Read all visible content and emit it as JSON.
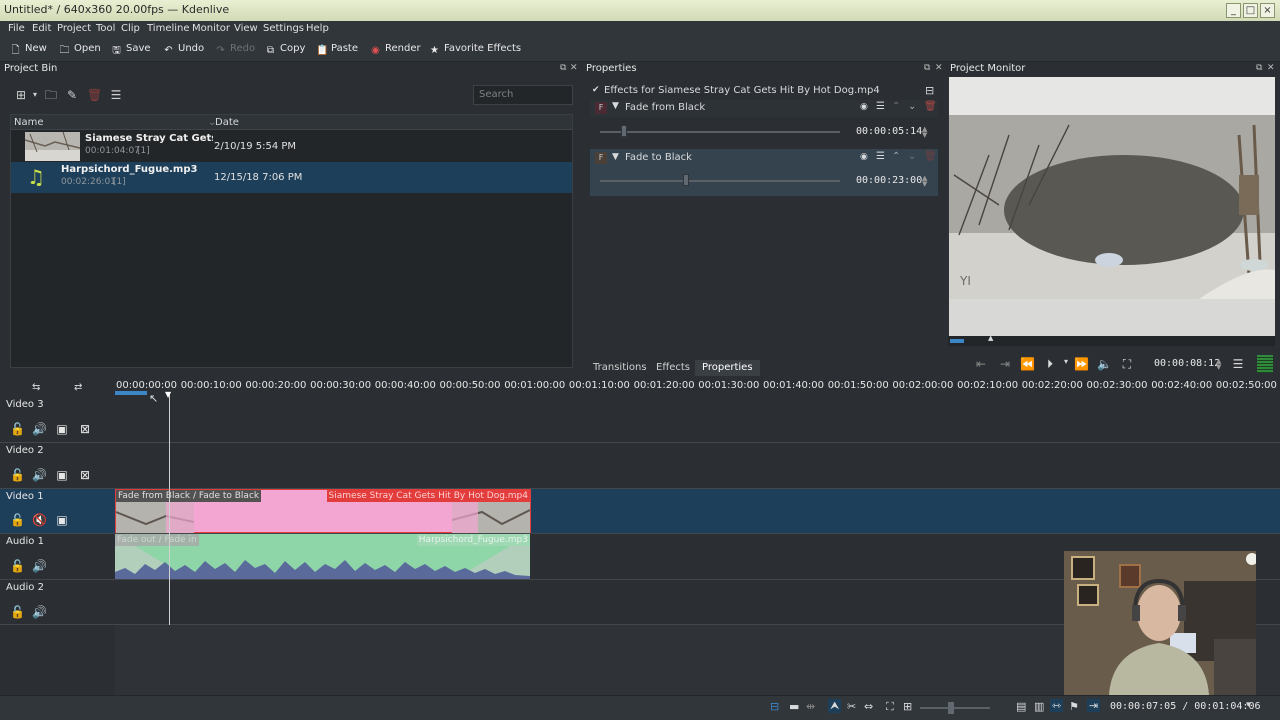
{
  "window": {
    "title": "Untitled* / 640x360 20.00fps — Kdenlive"
  },
  "menu": [
    "File",
    "Edit",
    "Project",
    "Tool",
    "Clip",
    "Timeline",
    "Monitor",
    "View",
    "Settings",
    "Help"
  ],
  "toolbar": {
    "new": "New",
    "open": "Open",
    "save": "Save",
    "undo": "Undo",
    "redo": "Redo",
    "copy": "Copy",
    "paste": "Paste",
    "render": "Render",
    "favorite_effects": "Favorite Effects"
  },
  "project_bin": {
    "title": "Project Bin",
    "search_placeholder": "Search",
    "columns": {
      "name": "Name",
      "date": "Date"
    },
    "items": [
      {
        "name": "Siamese Stray Cat Gets Hit By",
        "duration": "00:01:04:07",
        "count": "[1]",
        "date": "2/10/19 5:54 PM"
      },
      {
        "name": "Harpsichord_Fugue.mp3",
        "duration": "00:02:26:01",
        "count": "[1]",
        "date": "12/15/18 7:06 PM"
      }
    ]
  },
  "properties": {
    "title": "Properties",
    "effects_for": "Effects for Siamese Stray Cat Gets Hit By Hot Dog.mp4",
    "effects": [
      {
        "name": "Fade from Black",
        "timecode": "00:00:05:14",
        "slider": 0.1
      },
      {
        "name": "Fade to Black",
        "timecode": "00:00:23:00",
        "slider": 0.36
      }
    ],
    "tabs": [
      "Transitions",
      "Effects",
      "Properties"
    ]
  },
  "monitor": {
    "title": "Project Monitor",
    "watermark": "YI",
    "timecode": "00:00:08:12"
  },
  "timeline": {
    "ruler": [
      "00:00:00:00",
      "00:00:10:00",
      "00:00:20:00",
      "00:00:30:00",
      "00:00:40:00",
      "00:00:50:00",
      "00:01:00:00",
      "00:01:10:00",
      "00:01:20:00",
      "00:01:30:00",
      "00:01:40:00",
      "00:01:50:00",
      "00:02:00:00",
      "00:02:10:00",
      "00:02:20:00",
      "00:02:30:00",
      "00:02:40:00",
      "00:02:50:00"
    ],
    "tracks": [
      "Video 3",
      "Video 2",
      "Video 1",
      "Audio 1",
      "Audio 2"
    ],
    "video_clip": {
      "effects_label": "Fade from Black / Fade to Black",
      "name": "Siamese Stray Cat Gets Hit By Hot Dog.mp4"
    },
    "audio_clip": {
      "effects_label": "Fade out / Fade in",
      "name": "Harpsichord_Fugue.mp3"
    }
  },
  "status": {
    "position": "00:00:07:05 / 00:01:04:06"
  },
  "colors": {
    "selection": "#1e3f5a",
    "video_clip": "#f4a6d2",
    "audio_clip": "#8ed6a8",
    "clip_border": "#e23c3c"
  }
}
